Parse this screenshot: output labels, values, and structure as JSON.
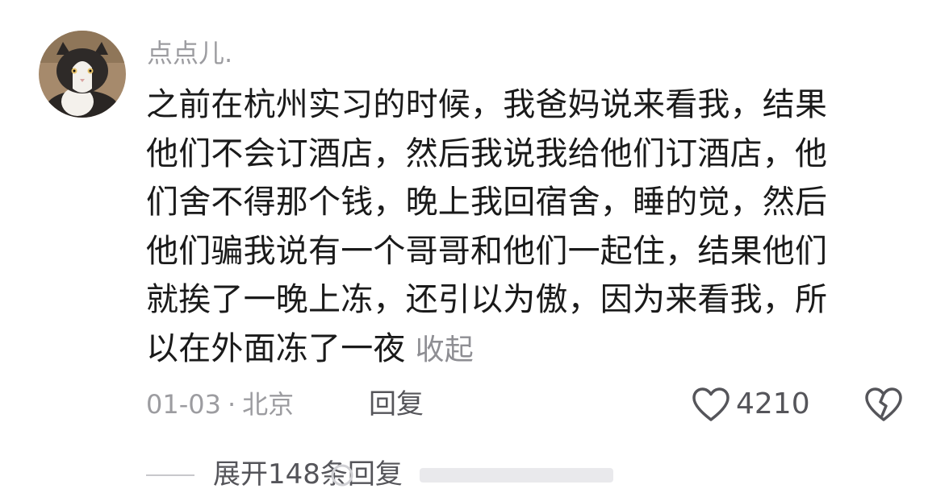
{
  "comment": {
    "username": "点点儿.",
    "lines": [
      "之前在杭州实习的时候，我爸妈说来看我，结果",
      "他们不会订酒店，然后我说我给他们订酒店，他",
      "们舍不得那个钱，晚上我回宿舍，睡的觉，然后",
      "他们骗我说有一个哥哥和他们一起住，结果他们",
      "就挨了一晚上冻，还引以为傲，因为来看我，所",
      "以在外面冻了一夜"
    ],
    "collapse_label": "收起",
    "date": "01-03",
    "separator": "·",
    "location": "北京",
    "reply_label": "回复",
    "like_count": "4210",
    "expand_replies_label": "展开148条回复"
  },
  "icons": {
    "like": "heart-outline-icon",
    "dislike": "broken-heart-icon"
  },
  "colors": {
    "text_primary": "#1a1a1a",
    "text_secondary": "#9c9ca0",
    "text_action": "#55555a"
  }
}
